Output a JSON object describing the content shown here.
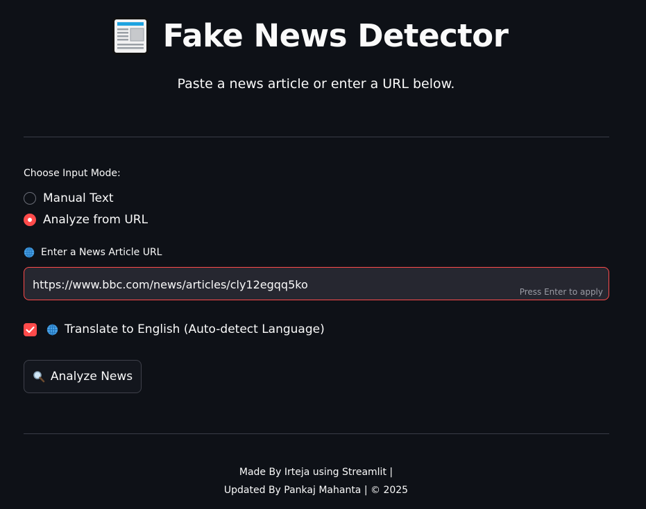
{
  "header": {
    "title": "Fake News Detector",
    "logo_icon": "newspaper-icon",
    "subtitle": "Paste a news article or enter a URL below."
  },
  "input_mode": {
    "label": "Choose Input Mode:",
    "options": [
      {
        "label": "Manual Text",
        "selected": false
      },
      {
        "label": "Analyze from URL",
        "selected": true
      }
    ]
  },
  "url_field": {
    "label": "Enter a News Article URL",
    "label_icon": "globe-icon",
    "value": "https://www.bbc.com/news/articles/cly12egqq5ko",
    "hint": "Press Enter to apply"
  },
  "translate": {
    "label": "Translate to English (Auto-detect Language)",
    "icon": "globe-icon",
    "checked": true
  },
  "analyze_button": {
    "label": "Analyze News",
    "icon": "magnifier-icon"
  },
  "footer": {
    "line1": "Made By Irteja using Streamlit |",
    "line2": "Updated By Pankaj Mahanta | © 2025"
  },
  "colors": {
    "background": "#0e1117",
    "accent": "#ff4b4b",
    "input_bg": "#262730",
    "text": "#fafafa"
  }
}
